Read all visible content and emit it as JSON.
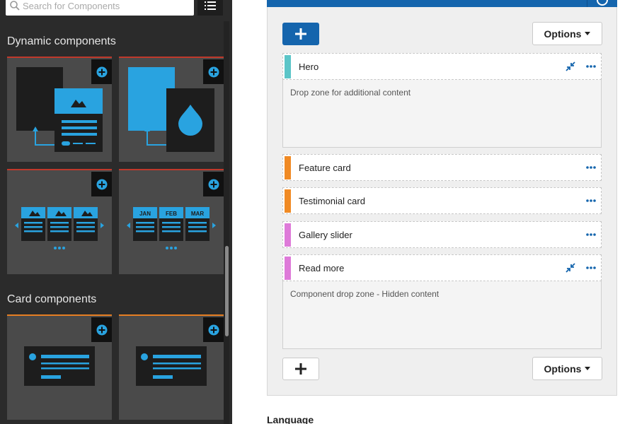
{
  "search": {
    "placeholder": "Search for Components"
  },
  "sidebar": {
    "sections": [
      {
        "heading": "Dynamic components"
      },
      {
        "heading": "Card components"
      }
    ],
    "carousel_months": [
      "JAN",
      "FEB",
      "MAR"
    ]
  },
  "main": {
    "add_label": "+",
    "options_label": "Options",
    "components": [
      {
        "label": "Hero",
        "accent": "#5bc5c8",
        "drop_zone": "Drop zone for additional content"
      },
      {
        "label": "Feature card",
        "accent": "#f08a24"
      },
      {
        "label": "Testimonial card",
        "accent": "#f08a24"
      },
      {
        "label": "Gallery slider",
        "accent": "#de7ad9"
      },
      {
        "label": "Read more",
        "accent": "#de7ad9",
        "drop_zone": "Component drop zone - Hidden content"
      }
    ],
    "language_label": "Language"
  },
  "colors": {
    "primary_blue": "#1565ad",
    "art_blue": "#29a3e0",
    "dynamic_accent": "#c0392b",
    "card_accent": "#e67e22"
  }
}
